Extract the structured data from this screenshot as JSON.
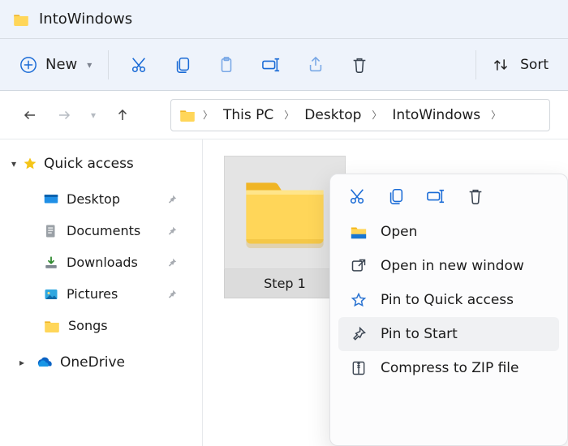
{
  "title": "IntoWindows",
  "toolbar": {
    "new_label": "New",
    "sort_label": "Sort"
  },
  "breadcrumbs": [
    "This PC",
    "Desktop",
    "IntoWindows"
  ],
  "sidebar": {
    "quick_access_label": "Quick access",
    "items": [
      {
        "label": "Desktop",
        "icon": "desktop-icon",
        "pinned": true
      },
      {
        "label": "Documents",
        "icon": "documents-icon",
        "pinned": true
      },
      {
        "label": "Downloads",
        "icon": "downloads-icon",
        "pinned": true
      },
      {
        "label": "Pictures",
        "icon": "pictures-icon",
        "pinned": true
      },
      {
        "label": "Songs",
        "icon": "folder-icon",
        "pinned": false
      }
    ],
    "onedrive_label": "OneDrive"
  },
  "content": {
    "selected_item_label": "Step 1"
  },
  "context_menu": {
    "items": [
      {
        "label": "Open",
        "icon": "open-icon"
      },
      {
        "label": "Open in new window",
        "icon": "open-new-window-icon"
      },
      {
        "label": "Pin to Quick access",
        "icon": "star-outline-icon"
      },
      {
        "label": "Pin to Start",
        "icon": "pin-icon",
        "hover": true
      },
      {
        "label": "Compress to ZIP file",
        "icon": "zip-icon"
      }
    ]
  }
}
